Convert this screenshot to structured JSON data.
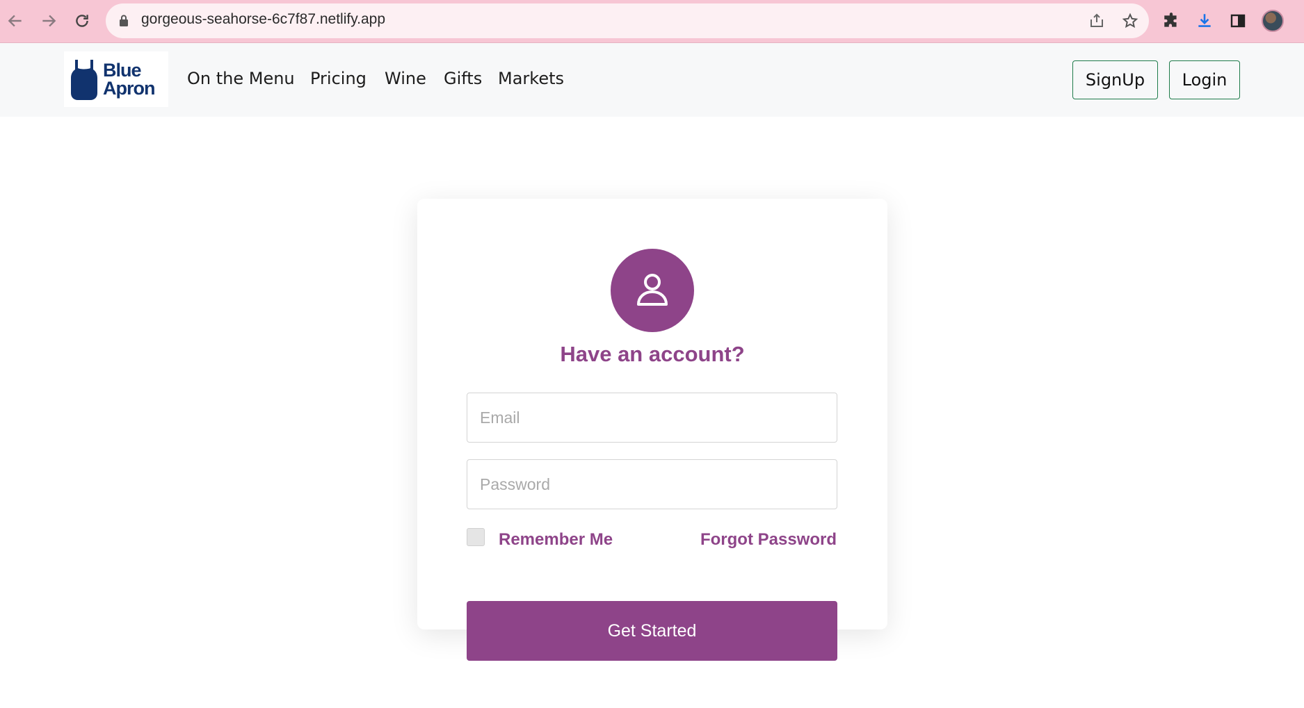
{
  "browser": {
    "url": "gorgeous-seahorse-6c7f87.netlify.app",
    "icons": [
      "back-arrow-icon",
      "forward-arrow-icon",
      "reload-icon",
      "lock-icon",
      "share-icon",
      "star-icon",
      "extensions-icon",
      "download-icon",
      "side-panel-icon",
      "profile-avatar"
    ]
  },
  "header": {
    "logo_line1": "Blue",
    "logo_line2": "Apron",
    "nav": {
      "menu": "On the Menu",
      "pricing": "Pricing",
      "wine": "Wine",
      "gifts": "Gifts",
      "markets": "Markets"
    },
    "signup_label": "SignUp",
    "login_label": "Login"
  },
  "login_card": {
    "title": "Have an account?",
    "email_placeholder": "Email",
    "email_value": "",
    "password_placeholder": "Password",
    "password_value": "",
    "remember_label": "Remember Me",
    "remember_checked": false,
    "forgot_label": "Forgot Password",
    "submit_label": "Get Started"
  },
  "colors": {
    "accent": "#8e4489",
    "brand_blue": "#11336e",
    "browser_bar": "#f7c6d4",
    "button_border": "#1e7b4a"
  }
}
